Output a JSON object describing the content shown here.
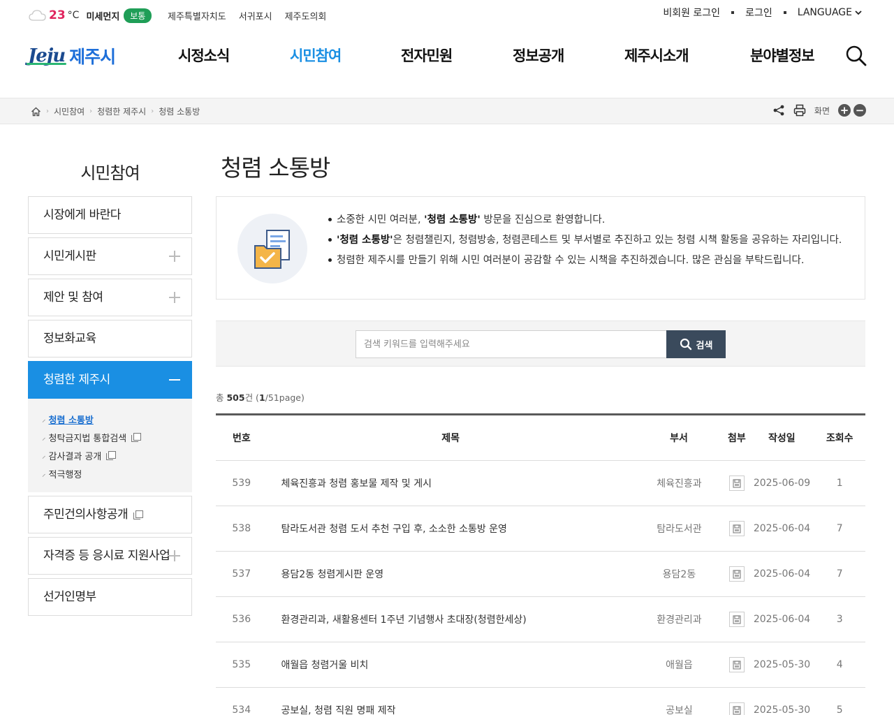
{
  "weather": {
    "temp": "23",
    "unit": "°C",
    "dust_label": "미세먼지",
    "dust_status": "보통",
    "dust_color": "#1f9e57"
  },
  "top_links": [
    "제주특별자치도",
    "서귀포시",
    "제주도의회"
  ],
  "top_right": {
    "guest_login": "비회원 로그인",
    "login": "로그인",
    "language": "LANGUAGE"
  },
  "logo": {
    "en": "Jeju",
    "kr": "제주시"
  },
  "menu": [
    "시정소식",
    "시민참여",
    "전자민원",
    "정보공개",
    "제주시소개",
    "분야별정보"
  ],
  "breadcrumb": [
    "시민참여",
    "청렴한 제주시",
    "청렴 소통방"
  ],
  "crumb_tools": {
    "screen": "화면"
  },
  "lnb": {
    "title": "시민참여",
    "items": [
      "시장에게 바란다",
      "시민게시판",
      "제안 및 참여",
      "정보화교육",
      "청렴한 제주시",
      "주민건의사항공개",
      "자격증 등 응시료 지원사업",
      "선거인명부"
    ],
    "sub": [
      "청렴 소통방",
      "청탁금지법 통합검색",
      "감사결과 공개",
      "적극행정"
    ]
  },
  "page_title": "청렴 소통방",
  "intro": {
    "line1_pre": "소중한 시민 여러분, ",
    "line1_bold": "'청렴 소통방'",
    "line1_post": " 방문을 진심으로 환영합니다.",
    "line2_bold": "'청렴 소통방'",
    "line2_post": "은 청렴챌린지, 청렴방송, 청렴콘테스트 및 부서별로 추진하고 있는 청렴 시책 활동을 공유하는 자리입니다.",
    "line3": "청렴한 제주시를 만들기 위해 시민 여러분이 공감할 수 있는 시책을 추진하겠습니다. 많은 관심을 부탁드립니다."
  },
  "search": {
    "placeholder": "검색 키워드를 입력해주세요",
    "button": "검색"
  },
  "count": {
    "prefix": "총 ",
    "total": "505",
    "unit": "건 (",
    "page": "1",
    "pages": "/51page)"
  },
  "board": {
    "headers": {
      "no": "번호",
      "title": "제목",
      "dept": "부서",
      "file": "첨부",
      "date": "작성일",
      "hits": "조회수"
    },
    "rows": [
      {
        "no": "539",
        "title": "체육진흥과 청렴 홍보물 제작 및 게시",
        "dept": "체육진흥과",
        "date": "2025-06-09",
        "hits": "1"
      },
      {
        "no": "538",
        "title": "탐라도서관 청렴 도서 추천 구입 후, 소소한 소통방 운영",
        "dept": "탐라도서관",
        "date": "2025-06-04",
        "hits": "7"
      },
      {
        "no": "537",
        "title": "용담2동 청렴게시판 운영",
        "dept": "용담2동",
        "date": "2025-06-04",
        "hits": "7"
      },
      {
        "no": "536",
        "title": "환경관리과, 새활용센터 1주년 기념행사 초대장(청렴한세상)",
        "dept": "환경관리과",
        "date": "2025-06-04",
        "hits": "3"
      },
      {
        "no": "535",
        "title": "애월읍 청렴거울 비치",
        "dept": "애월읍",
        "date": "2025-05-30",
        "hits": "4"
      },
      {
        "no": "534",
        "title": "공보실, 청렴 직원 명패 제작",
        "dept": "공보실",
        "date": "2025-05-30",
        "hits": "5"
      }
    ]
  },
  "colors": {
    "accent": "#1a8fe3",
    "temp": "#e0245e",
    "search_button": "#3a4a5c"
  }
}
